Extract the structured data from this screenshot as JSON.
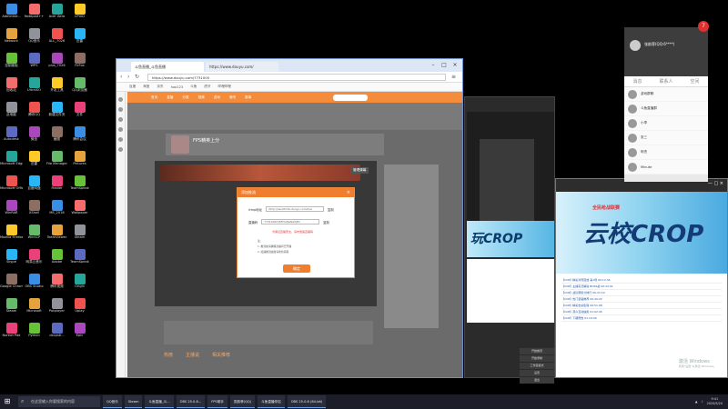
{
  "desktop": {
    "icons_col1": [
      "Administr...",
      "Network",
      "控制面板",
      "回收站",
      "此电脑",
      "Autodesk",
      "Microsoft Edge",
      "Microsoft Office",
      "WinRAR",
      "Mozilla Firefox",
      "Skype",
      "Google Chrome",
      "Steam",
      "Norton Pad"
    ],
    "icons_col2": [
      "Notepad++",
      "QQ音乐",
      "WPS",
      "UltraISO",
      "腾讯QQ",
      "微信",
      "迅雷",
      "百度网盘",
      "XShell",
      "WinSCP",
      "网易云音乐",
      "OBS Studio",
      "Microsoft",
      "Python"
    ],
    "icons_col3": [
      "Acer Aero",
      "ALL_7026",
      "plus_7026",
      "开发工具",
      "新建文件夹",
      "截图",
      "File Manager",
      "Fiddler",
      "MS_2016",
      "TeamViewer",
      "Adobe",
      "腾讯视频",
      "Potplayer",
      "dxcpstl..."
    ],
    "icons_col4": [
      "CPUID",
      "迅雷",
      "FirFox",
      "QQ浏览器",
      "文件",
      "腾讯会议",
      "Pictures",
      "TeamSpeak",
      "Wallpaper",
      "Steam",
      "TeamSpeak",
      "Origin",
      "Uplay",
      "Epic"
    ]
  },
  "browser": {
    "tabs": [
      "斗鱼直播_斗鱼直播",
      "https://www.douyu.com/"
    ],
    "url": "https://www.douyu.com/7731000",
    "bookmarks": [
      "百度",
      "淘宝",
      "京东",
      "hao123",
      "斗鱼",
      "虎牙",
      "哔哩哔哩"
    ],
    "nav": [
      "首页",
      "直播",
      "分类",
      "视频",
      "游戏",
      "鱼吧",
      "赛事"
    ],
    "room_title": "FPS精英上分",
    "footer_tabs": [
      "热榜",
      "主播说",
      "相关推荐"
    ]
  },
  "dialog": {
    "title": "添加推流",
    "close": "×",
    "server_label": "rtmp地址",
    "server_value": "rtmp://sendtc3a.douyu.com/live",
    "server_action": "复制",
    "key_label": "直播码",
    "key_value": "7731000r1BFhGfJwNa5jMc",
    "key_action": "复制",
    "hint": "为保证直播安全，请勿泄露直播码",
    "notes": [
      "注：",
      "1. 推流前请确保直播间已开播",
      "2. 如遇推流失败请重新获取"
    ],
    "ok_label": "确定"
  },
  "overlay_tag": "管理弹幕",
  "obs": {
    "cop": "玩CROP",
    "controls": [
      "开始推流",
      "开始录制",
      "工作室模式",
      "设置",
      "退出"
    ]
  },
  "live_window": {
    "title_icons": "— □ ×",
    "subtitle": "全民枪战联赛",
    "logo": "云校CROP",
    "lines": [
      "【COP】精彩对局回放 第1场 00:12:34",
      "【COP】主播实况解说 BOSS战 00:22:01",
      "【COP】战队赛积分排行 00:31:10",
      "【COP】热门装备推荐 00:40:22",
      "【COP】精彩击杀集锦 00:51:08",
      "【COP】观众互动抽奖 01:02:45",
      "【COP】下期预告 01:10:00"
    ],
    "activate": "激活 Windows",
    "activate_sub": "转到\"设置\"以激活 Windows。"
  },
  "qq": {
    "name": "张韵菲(QQ:6****)",
    "status": "在线",
    "badge": "7",
    "tabs": [
      "消息",
      "联系人",
      "空间"
    ],
    "items": [
      "游戏群聊",
      "斗鱼直播群",
      "小李",
      "张三",
      "阿杰",
      "Minute"
    ]
  },
  "taskbar": {
    "start": "⊞",
    "search_placeholder": "在这里输入你要搜索的内容",
    "tasks": [
      "QQ音乐",
      "Steam",
      "斗鱼直播_斗...",
      "OBS 25.0.8...",
      "FPS助手",
      "张韵菲(QQ)",
      "斗鱼直播伴侣",
      "OBS 25.0.8 (64-bit)"
    ],
    "time": "9:41",
    "date": "2020/5/20"
  }
}
